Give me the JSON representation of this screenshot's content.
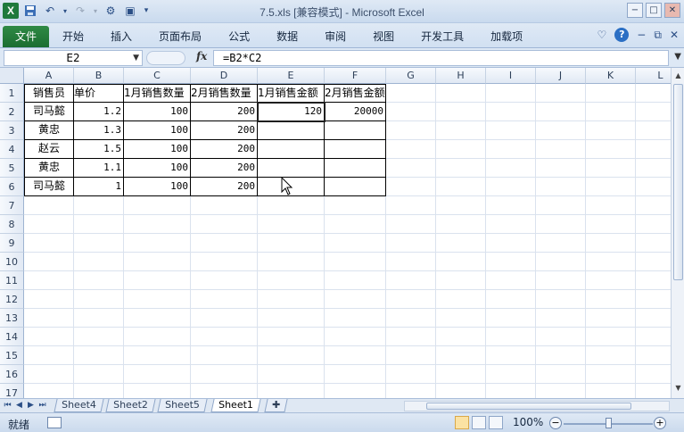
{
  "window": {
    "title": "7.5.xls  [兼容模式] - Microsoft Excel",
    "buttons": [
      "−",
      "□",
      "✕"
    ]
  },
  "ribbon": {
    "tabs": [
      "文件",
      "开始",
      "插入",
      "页面布局",
      "公式",
      "数据",
      "审阅",
      "视图",
      "开发工具",
      "加载项"
    ],
    "help_label": "?"
  },
  "formula_bar": {
    "name_box": "E2",
    "fx_label": "fx",
    "formula": "=B2*C2"
  },
  "grid": {
    "columns": [
      "A",
      "B",
      "C",
      "D",
      "E",
      "F",
      "G",
      "H",
      "I",
      "J",
      "K",
      "L"
    ],
    "rows": [
      "1",
      "2",
      "3",
      "4",
      "5",
      "6",
      "7",
      "8",
      "9",
      "10",
      "11",
      "12",
      "13",
      "14",
      "15",
      "16",
      "17"
    ],
    "cells": [
      [
        "销售员",
        "单价",
        "1月销售数量",
        "2月销售数量",
        "1月销售金额",
        "2月销售金额"
      ],
      [
        "司马懿",
        "1.2",
        "100",
        "200",
        "120",
        "20000"
      ],
      [
        "黄忠",
        "1.3",
        "100",
        "200",
        "",
        ""
      ],
      [
        "赵云",
        "1.5",
        "100",
        "200",
        "",
        ""
      ],
      [
        "黄忠",
        "1.1",
        "100",
        "200",
        "",
        ""
      ],
      [
        "司马懿",
        "1",
        "100",
        "200",
        "",
        ""
      ]
    ],
    "selected_cell": "E2"
  },
  "sheet_tabs": [
    "Sheet4",
    "Sheet2",
    "Sheet5",
    "Sheet1"
  ],
  "active_sheet": "Sheet1",
  "status": {
    "ready": "就绪",
    "zoom": "100%"
  }
}
